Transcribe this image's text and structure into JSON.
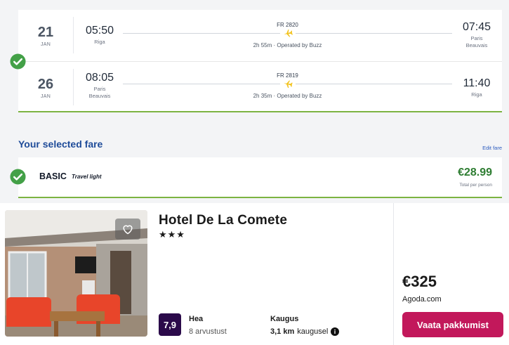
{
  "flights": [
    {
      "day": "21",
      "month": "JAN",
      "dep_time": "05:50",
      "dep_place": [
        "Riga"
      ],
      "flight_no": "FR 2820",
      "duration": "2h 55m · Operated by Buzz",
      "arr_time": "07:45",
      "arr_place": [
        "Paris",
        "Beauvais"
      ]
    },
    {
      "day": "26",
      "month": "JAN",
      "dep_time": "08:05",
      "dep_place": [
        "Paris",
        "Beauvais"
      ],
      "flight_no": "FR 2819",
      "duration": "2h 35m · Operated by Buzz",
      "arr_time": "11:40",
      "arr_place": [
        "Riga"
      ]
    }
  ],
  "fare": {
    "section_title": "Your selected fare",
    "edit_label": "Edit fare",
    "name": "BASIC",
    "subtitle": "Travel light",
    "price": "€28.99",
    "price_note": "Total per person"
  },
  "hotel": {
    "name": "Hotel De La Comete",
    "stars": "★★★",
    "rating": "7,9",
    "rating_label": "Hea",
    "reviews": "8 arvustust",
    "distance_label": "Kaugus",
    "distance_value": "3,1 km",
    "distance_suffix": "kaugusel",
    "price": "€325",
    "provider": "Agoda.com",
    "cta": "Vaata pakkumist"
  },
  "colors": {
    "check_green": "#43a047",
    "fare_price": "#2e7d32",
    "plane_yellow": "#f2c21b",
    "fare_title_blue": "#1e4b99",
    "rating_bg": "#2b0a4a",
    "cta_bg": "#c2185b"
  },
  "icons": [
    "check-circle-icon",
    "plane-icon",
    "heart-icon",
    "info-icon"
  ]
}
